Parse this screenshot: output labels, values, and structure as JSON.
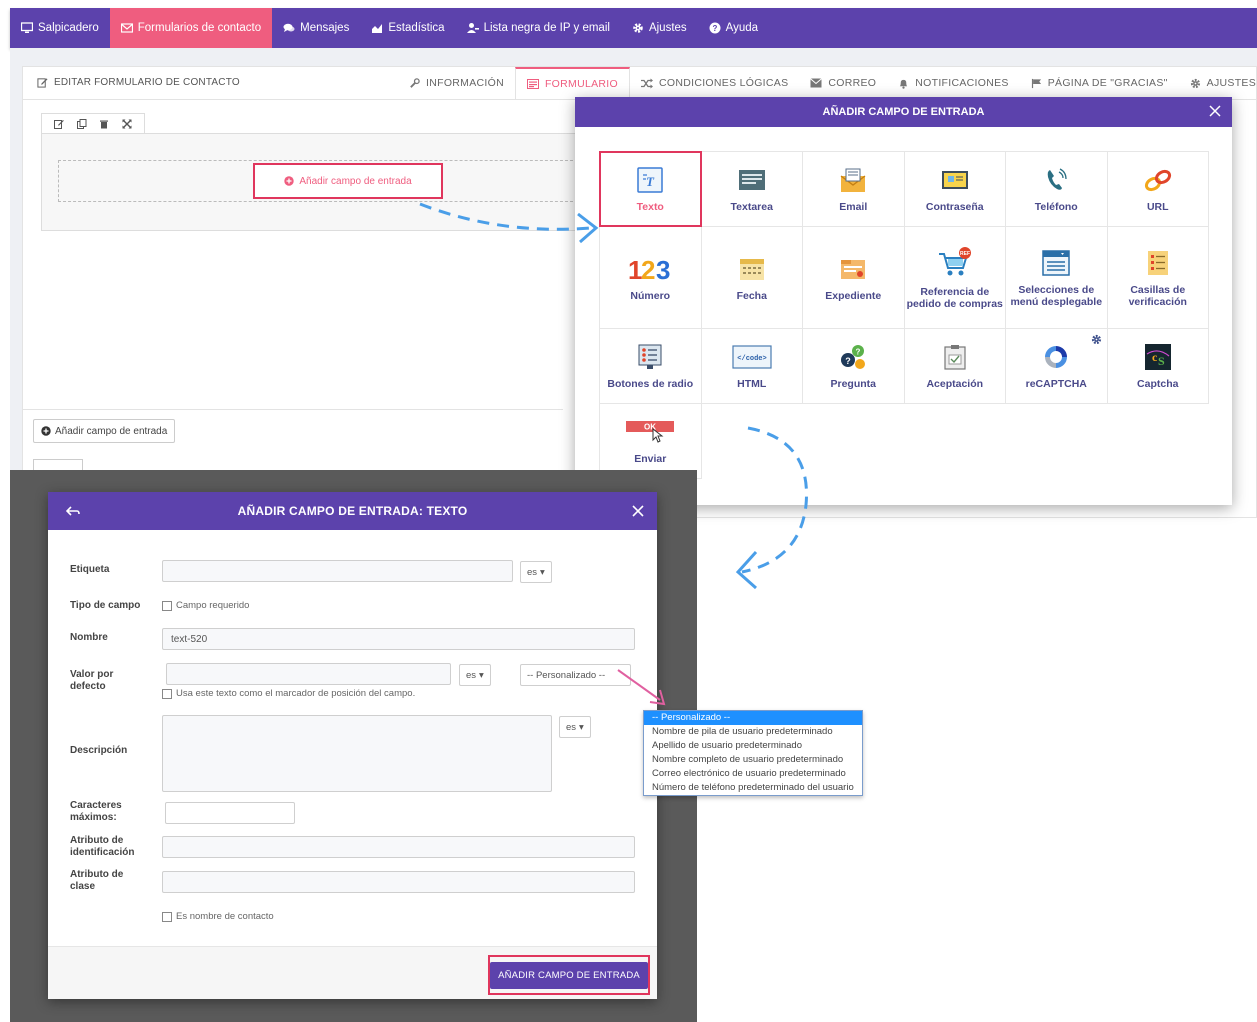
{
  "colors": {
    "brand": "#5c42ac",
    "accent": "#ef5d7f",
    "highlight": "#e0365d"
  },
  "topnav": {
    "items": [
      {
        "label": "Salpicadero",
        "icon": "monitor-icon"
      },
      {
        "label": "Formularios de contacto",
        "icon": "envelope-icon"
      },
      {
        "label": "Mensajes",
        "icon": "comments-icon"
      },
      {
        "label": "Estadística",
        "icon": "area-chart-icon"
      },
      {
        "label": "Lista negra de IP y email",
        "icon": "user-block-icon"
      },
      {
        "label": "Ajustes",
        "icon": "gear-icon"
      },
      {
        "label": "Ayuda",
        "icon": "question-icon"
      }
    ]
  },
  "editor": {
    "title": "EDITAR FORMULARIO DE CONTACTO",
    "tabs": [
      {
        "label": "INFORMACIÓN",
        "icon": "wrench-icon"
      },
      {
        "label": "FORMULARIO",
        "icon": "form-icon"
      },
      {
        "label": "CONDICIONES LÓGICAS",
        "icon": "shuffle-icon"
      },
      {
        "label": "CORREO",
        "icon": "envelope-icon"
      },
      {
        "label": "NOTIFICACIONES",
        "icon": "bell-icon"
      },
      {
        "label": "PÁGINA DE \"GRACIAS\"",
        "icon": "flag-icon"
      },
      {
        "label": "AJUSTES",
        "icon": "gear-icon"
      }
    ],
    "more": "•••",
    "add_field_center": "Añadir campo de entrada",
    "add_field_button": "Añadir campo de entrada"
  },
  "picker": {
    "title": "AÑADIR CAMPO DE ENTRADA",
    "fields": [
      {
        "label": "Texto",
        "icon": "text-field-icon"
      },
      {
        "label": "Textarea",
        "icon": "textarea-icon"
      },
      {
        "label": "Email",
        "icon": "email-icon"
      },
      {
        "label": "Contraseña",
        "icon": "password-icon"
      },
      {
        "label": "Teléfono",
        "icon": "phone-icon"
      },
      {
        "label": "URL",
        "icon": "link-icon"
      },
      {
        "label": "Número",
        "icon": "number-icon"
      },
      {
        "label": "Fecha",
        "icon": "calendar-icon"
      },
      {
        "label": "Expediente",
        "icon": "file-icon"
      },
      {
        "label": "Referencia de pedido de compras",
        "icon": "shopping-cart-icon"
      },
      {
        "label": "Selecciones de menú desplegable",
        "icon": "dropdown-icon"
      },
      {
        "label": "Casillas de verificación",
        "icon": "checkbox-icon"
      },
      {
        "label": "Botones de radio",
        "icon": "radio-icon"
      },
      {
        "label": "HTML",
        "icon": "code-icon"
      },
      {
        "label": "Pregunta",
        "icon": "question-bubble-icon"
      },
      {
        "label": "Aceptación",
        "icon": "clipboard-check-icon"
      },
      {
        "label": "reCAPTCHA",
        "icon": "recaptcha-icon"
      },
      {
        "label": "Captcha",
        "icon": "captcha-icon"
      },
      {
        "label": "Enviar",
        "icon": "submit-icon"
      }
    ],
    "submit_badge": "OK"
  },
  "text_modal": {
    "title": "AÑADIR CAMPO DE ENTRADA:  TEXTO",
    "labels": {
      "etiqueta": "Etiqueta",
      "tipo": "Tipo de campo",
      "nombre": "Nombre",
      "valor_1": "Valor por",
      "valor_2": "defecto",
      "descripcion": "Descripción",
      "caracteres_1": "Caracteres",
      "caracteres_2": "máximos:",
      "atrib_id_1": "Atributo de",
      "atrib_id_2": "identificación",
      "atrib_cl_1": "Atributo de",
      "atrib_cl_2": "clase"
    },
    "lang": "es",
    "required_checkbox": "Campo requerido",
    "name_value": "text-520",
    "default_select": "-- Personalizado --",
    "placeholder_checkbox": "Usa este texto como el marcador de posición del campo.",
    "contact_name_checkbox": "Es nombre de contacto",
    "submit": "AÑADIR CAMPO DE ENTRADA"
  },
  "dropdown": {
    "options": [
      "-- Personalizado --",
      "Nombre de pila de usuario predeterminado",
      "Apellido de usuario predeterminado",
      "Nombre completo de usuario predeterminado",
      "Correo electrónico de usuario predeterminado",
      "Número de teléfono predeterminado del usuario"
    ]
  }
}
